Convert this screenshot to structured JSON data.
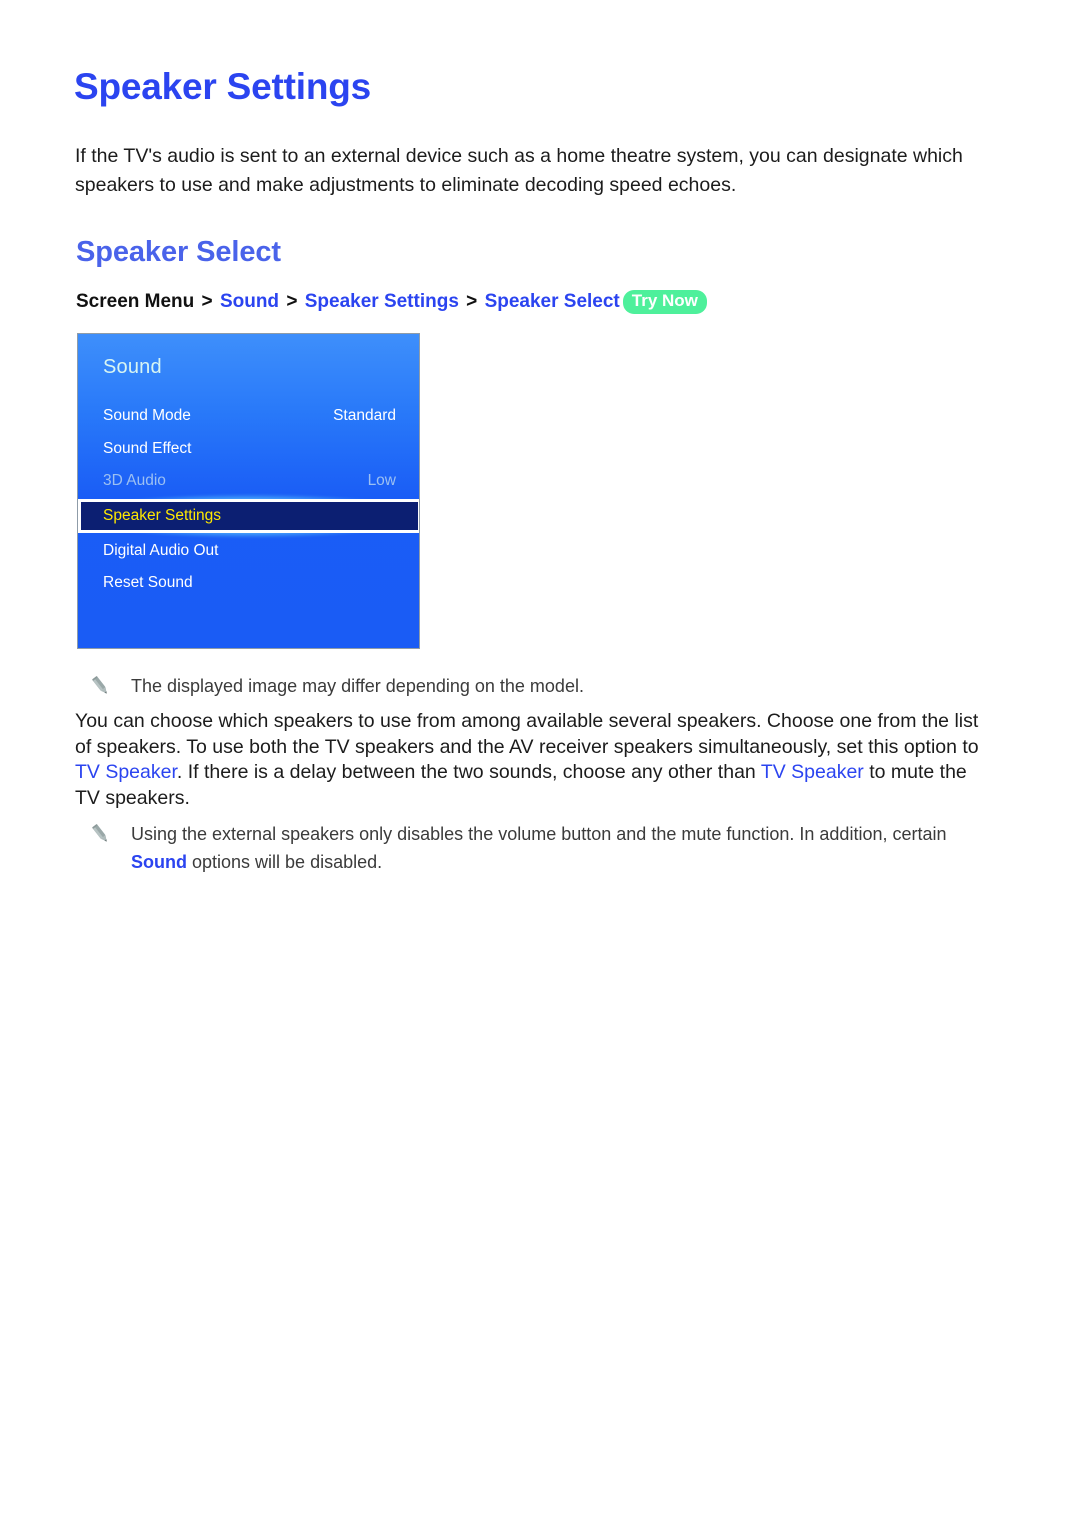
{
  "document": {
    "title": "Speaker Settings",
    "intro": "If the TV's audio is sent to an external device such as a home theatre system, you can designate which speakers to use and make adjustments to eliminate decoding speed echoes.",
    "section_title": "Speaker Select"
  },
  "breadcrumb": {
    "root": "Screen Menu",
    "separator": ">",
    "links": [
      "Sound",
      "Speaker Settings",
      "Speaker Select"
    ],
    "badge": "Try Now"
  },
  "tv_menu": {
    "title": "Sound",
    "rows": [
      {
        "label": "Sound Mode",
        "value": "Standard",
        "state": "normal"
      },
      {
        "label": "Sound Effect",
        "value": "",
        "state": "normal"
      },
      {
        "label": "3D Audio",
        "value": "Low",
        "state": "disabled"
      },
      {
        "label": "Speaker Settings",
        "value": "",
        "state": "selected"
      },
      {
        "label": "Digital Audio Out",
        "value": "",
        "state": "normal"
      },
      {
        "label": "Reset Sound",
        "value": "",
        "state": "normal"
      }
    ]
  },
  "notes": [
    {
      "icon": "pencil-icon",
      "text": "The displayed image may differ depending on the model."
    },
    {
      "icon": "pencil-icon",
      "text_before": "Using the external speakers only disables the volume button and the mute function. In addition, certain ",
      "highlight": "Sound",
      "text_after": " options will be disabled."
    }
  ],
  "body_paragraph": {
    "part1": "You can choose which speakers to use from among available several speakers. Choose one from the list of speakers. To use both the TV speakers and the AV receiver speakers simultaneously, set this option to ",
    "highlight1": "TV Speaker",
    "part2": ". If there is a delay between the two sounds, choose any other than ",
    "highlight2": "TV Speaker",
    "part3": " to mute the TV speakers."
  },
  "colors": {
    "heading_blue": "#2b44f0",
    "section_blue": "#4a63ea",
    "badge_green": "#4ef09b",
    "menu_blue": "#1a5cf5",
    "selected_navy": "#0c1f72",
    "selected_text_yellow": "#ffe800",
    "glow_cyan": "#78f0ff",
    "disabled_text": "#9cc0f2"
  }
}
